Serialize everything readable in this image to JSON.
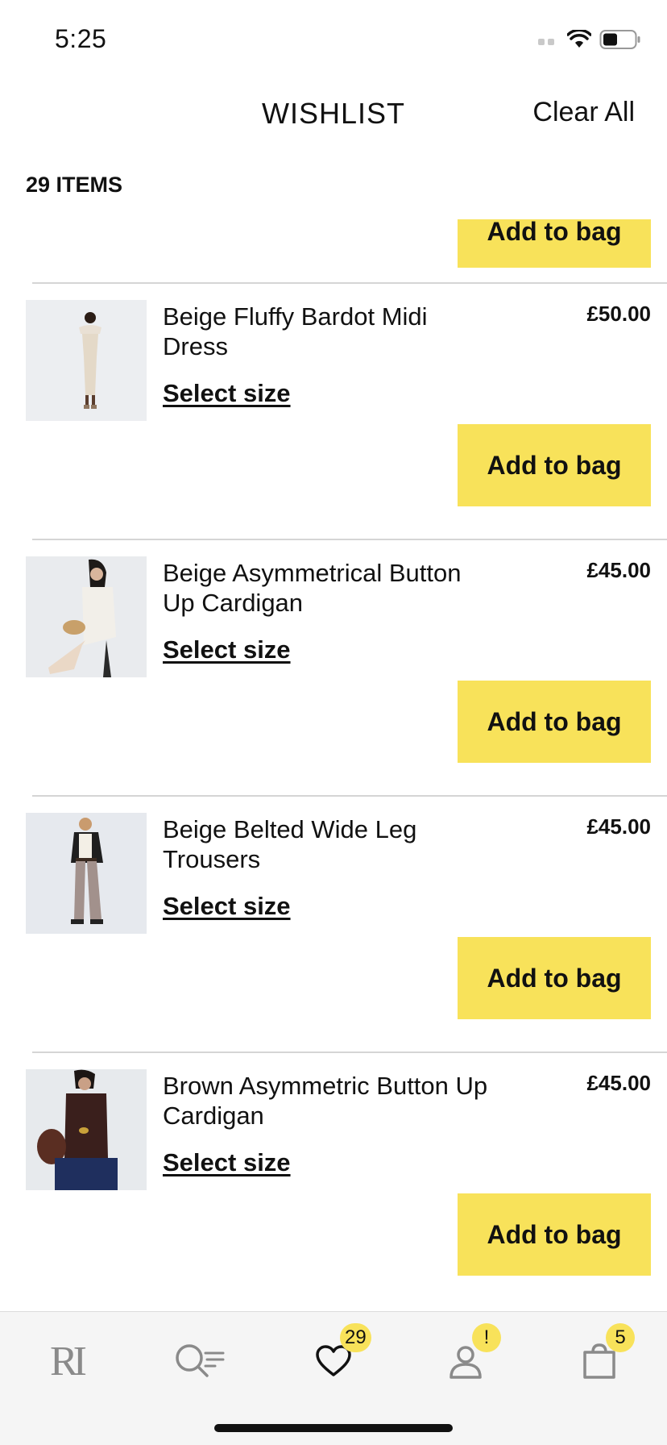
{
  "status_bar": {
    "time": "5:25"
  },
  "header": {
    "title": "WISHLIST",
    "clear_all": "Clear All"
  },
  "items_count": "29 ITEMS",
  "partial_item": {
    "add_to_bag": "Add to bag"
  },
  "items": [
    {
      "name": "Beige Fluffy Bardot Midi  Dress",
      "price": "£50.00",
      "select_size": "Select size",
      "add_to_bag": "Add to bag"
    },
    {
      "name": "Beige Asymmetrical Button Up Cardigan",
      "price": "£45.00",
      "select_size": "Select size",
      "add_to_bag": "Add to bag"
    },
    {
      "name": "Beige Belted Wide Leg Trousers",
      "price": "£45.00",
      "select_size": "Select size",
      "add_to_bag": "Add to bag"
    },
    {
      "name": "Brown Asymmetric Button Up Cardigan",
      "price": "£45.00",
      "select_size": "Select size",
      "add_to_bag": "Add to bag"
    }
  ],
  "tab_bar": {
    "logo": "RI",
    "wishlist_badge": "29",
    "account_badge": "!",
    "bag_badge": "5",
    "icons": [
      "logo-icon",
      "search-icon",
      "heart-icon",
      "account-icon",
      "bag-icon"
    ]
  },
  "colors": {
    "accent": "#f8e25a",
    "divider": "#d5d5d5",
    "tab_bg": "#f5f5f5"
  }
}
